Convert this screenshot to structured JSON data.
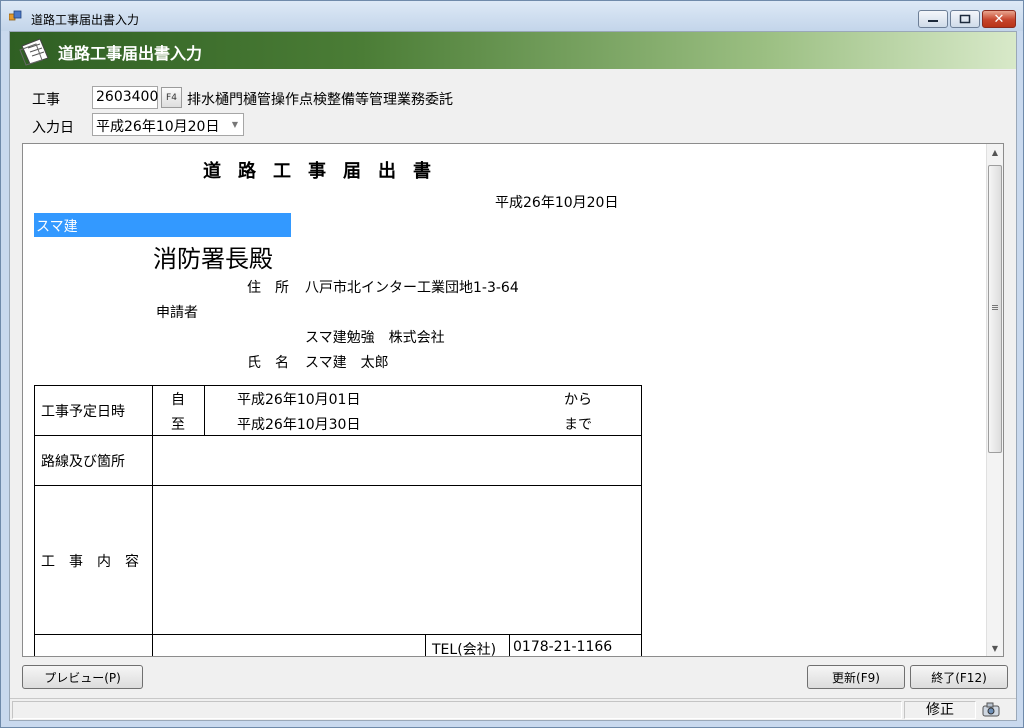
{
  "window": {
    "title": "道路工事届出書入力",
    "controls": {
      "minimize": "▭",
      "maximize": "□",
      "close": "✕"
    }
  },
  "header": {
    "title": "道路工事届出書入力",
    "icon": "document-icon"
  },
  "form": {
    "construction_label": "工事",
    "construction_code": "2603400",
    "lookup_button": "F4",
    "construction_name": "排水樋門樋管操作点検整備等管理業務委託",
    "entry_date_label": "入力日",
    "entry_date": "平成26年10月20日"
  },
  "document": {
    "title": "道路工事届出書",
    "date": "平成26年10月20日",
    "to_field": "スマ建",
    "addressee": "消防署長殿",
    "address_label": "住　所",
    "address": "八戸市北インター工業団地1-3-64",
    "applicant_label": "申請者",
    "company": "スマ建勉強　株式会社",
    "name_label": "氏　名",
    "name": "スマ建　太郎",
    "table": {
      "schedule_label": "工事予定日時",
      "from_label": "自",
      "to_label": "至",
      "from_date": "平成26年10月01日",
      "to_date": "平成26年10月30日",
      "from_suffix": "から",
      "to_suffix": "まで",
      "route_label": "路線及び箇所",
      "content_label": "工　事　内　容",
      "tel_label": "TEL(会社)",
      "tel": "0178-21-1166"
    }
  },
  "buttons": {
    "preview": "プレビュー(P)",
    "update": "更新(F9)",
    "exit": "終了(F12)"
  },
  "status": {
    "mode": "修正"
  },
  "colors": {
    "header_dark": "#2f5f23",
    "selection": "#3399ff",
    "close_button": "#c6452c"
  }
}
